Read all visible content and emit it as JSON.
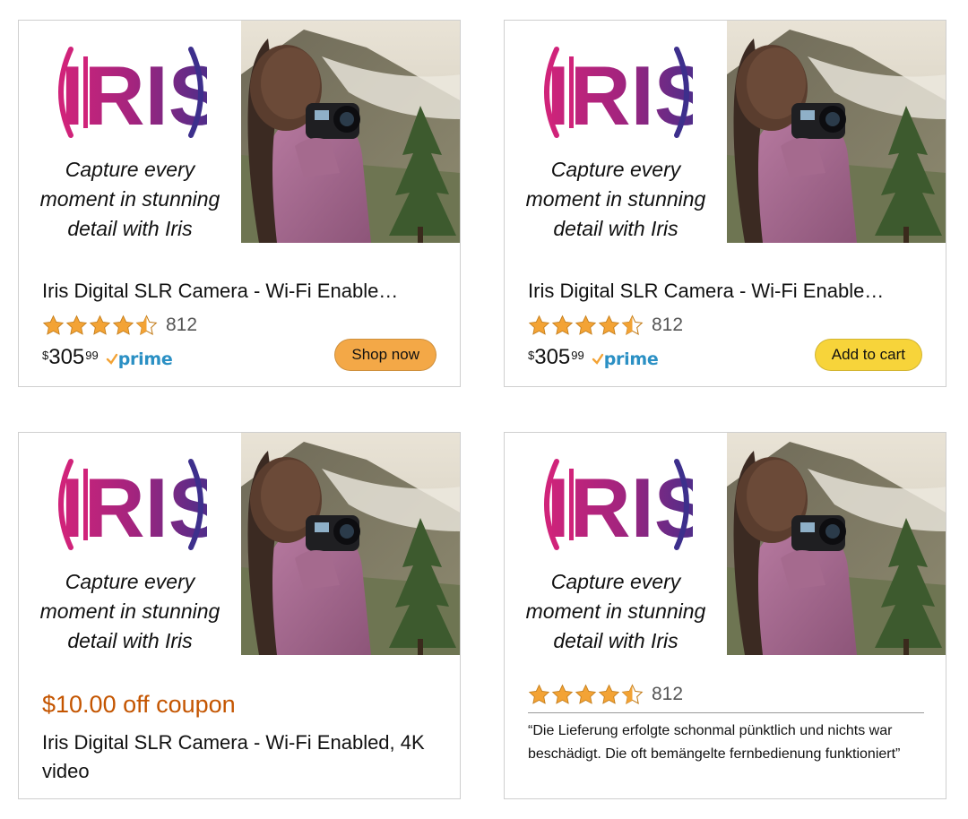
{
  "colors": {
    "coupon": "#c45500",
    "shop_now_button": "#f3a847",
    "add_to_cart_button": "#f7d43a",
    "prime_blue": "#2b90c4",
    "star_gold": "#f3a335"
  },
  "brand": {
    "logo_text": "IRIS",
    "tagline": "Capture every moment in stunning detail with Iris"
  },
  "product": {
    "title_truncated": "Iris Digital SLR Camera - Wi-Fi Enable…",
    "title_full": "Iris Digital SLR Camera - Wi-Fi Enabled, 4K video",
    "rating": 4.5,
    "review_count": "812",
    "price_symbol": "$",
    "price_whole": "305",
    "price_fraction": "99",
    "prime_label": "prime"
  },
  "cards": {
    "card1": {
      "cta_label": "Shop now"
    },
    "card2": {
      "cta_label": "Add to cart"
    },
    "card3": {
      "coupon_text": "$10.00 off coupon"
    },
    "card4": {
      "review_quote": "“Die Lieferung erfolgte schonmal pünktlich und nichts war beschädigt. Die oft bemängelte fernbedienung funktioniert”"
    }
  }
}
